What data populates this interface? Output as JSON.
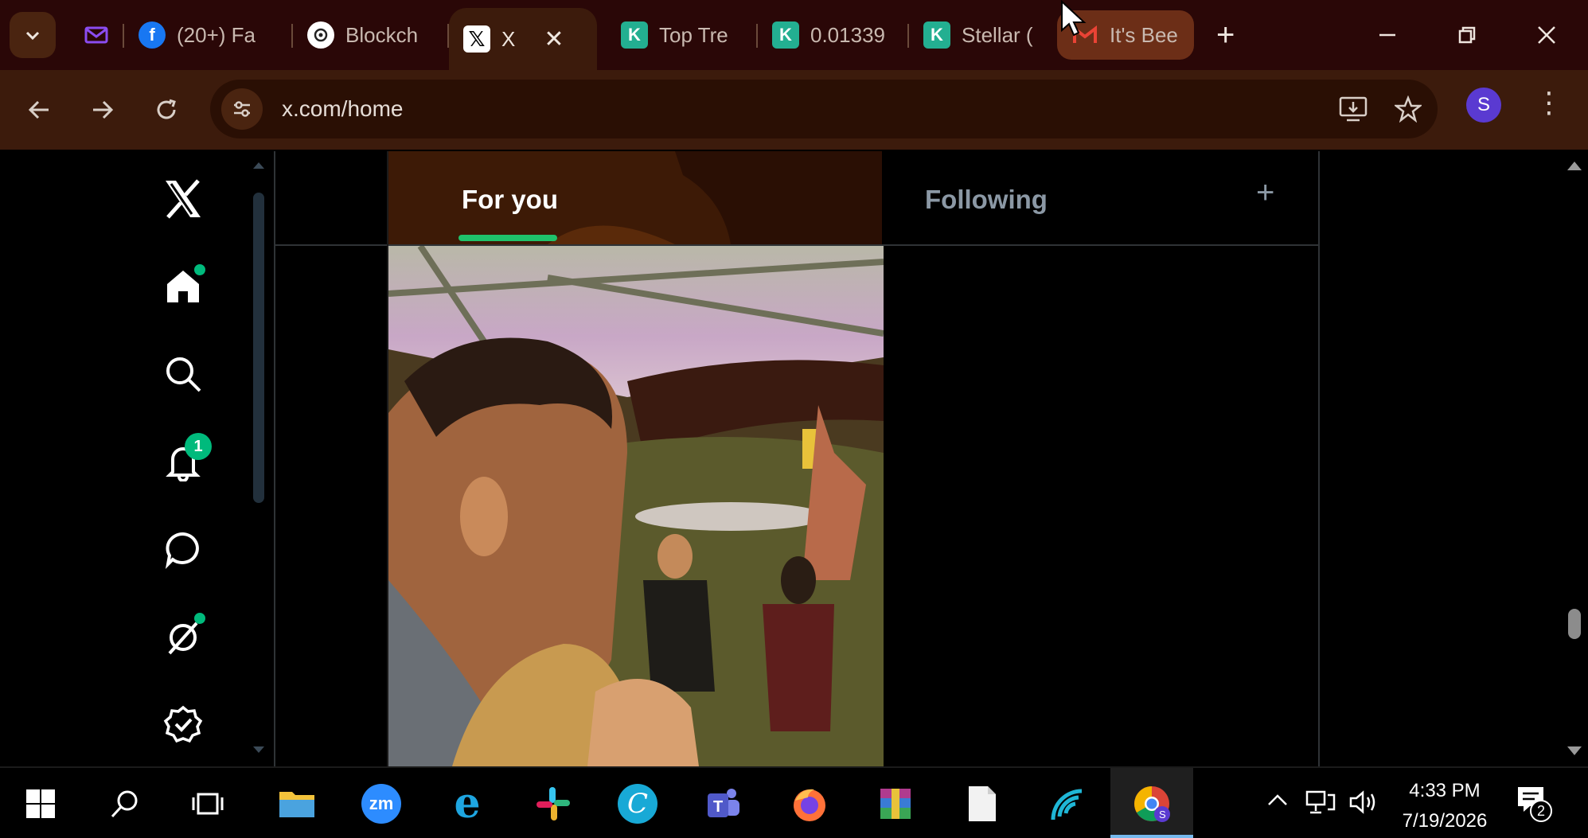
{
  "browser": {
    "tabs": [
      {
        "title": "",
        "favicon": "mail-icon",
        "color": "#7b3fe4"
      },
      {
        "title": "(20+) Fa",
        "favicon": "facebook-icon",
        "color": "#1877f2"
      },
      {
        "title": "Blockch",
        "favicon": "openai-icon",
        "color": "#ffffff"
      },
      {
        "title": "X",
        "favicon": "x-logo-icon",
        "color": "#ffffff",
        "active": true
      },
      {
        "title": "Top Tre",
        "favicon": "kucoin-icon",
        "color": "#23af91"
      },
      {
        "title": "0.01339",
        "favicon": "kucoin-icon",
        "color": "#23af91"
      },
      {
        "title": "Stellar (",
        "favicon": "kucoin-icon",
        "color": "#23af91"
      },
      {
        "title": "It's Bee",
        "favicon": "gmail-icon",
        "color": "#ea4335"
      }
    ],
    "close_symbol": "✕",
    "new_tab_symbol": "+",
    "url": "x.com/home",
    "profile_initial": "S"
  },
  "x_home": {
    "tabs": {
      "for_you": "For you",
      "following": "Following"
    },
    "add_symbol": "+",
    "notifications_count": "1"
  },
  "taskbar": {
    "time": "4:33 PM",
    "date": "7/19/2026",
    "notification_count": "2",
    "apps": [
      "windows-start-icon",
      "search-icon",
      "task-view-icon",
      "file-explorer-icon",
      "zoom-icon",
      "internet-explorer-icon",
      "slack-icon",
      "canva-icon",
      "teams-icon",
      "firefox-icon",
      "winrar-icon",
      "notepad-icon",
      "wireless-app-icon",
      "chrome-icon"
    ],
    "zoom_label": "zm"
  },
  "colors": {
    "accent_green": "#00ba7c",
    "tab_bg": "#2a0707",
    "toolbar_bg": "#3c1b0c"
  }
}
